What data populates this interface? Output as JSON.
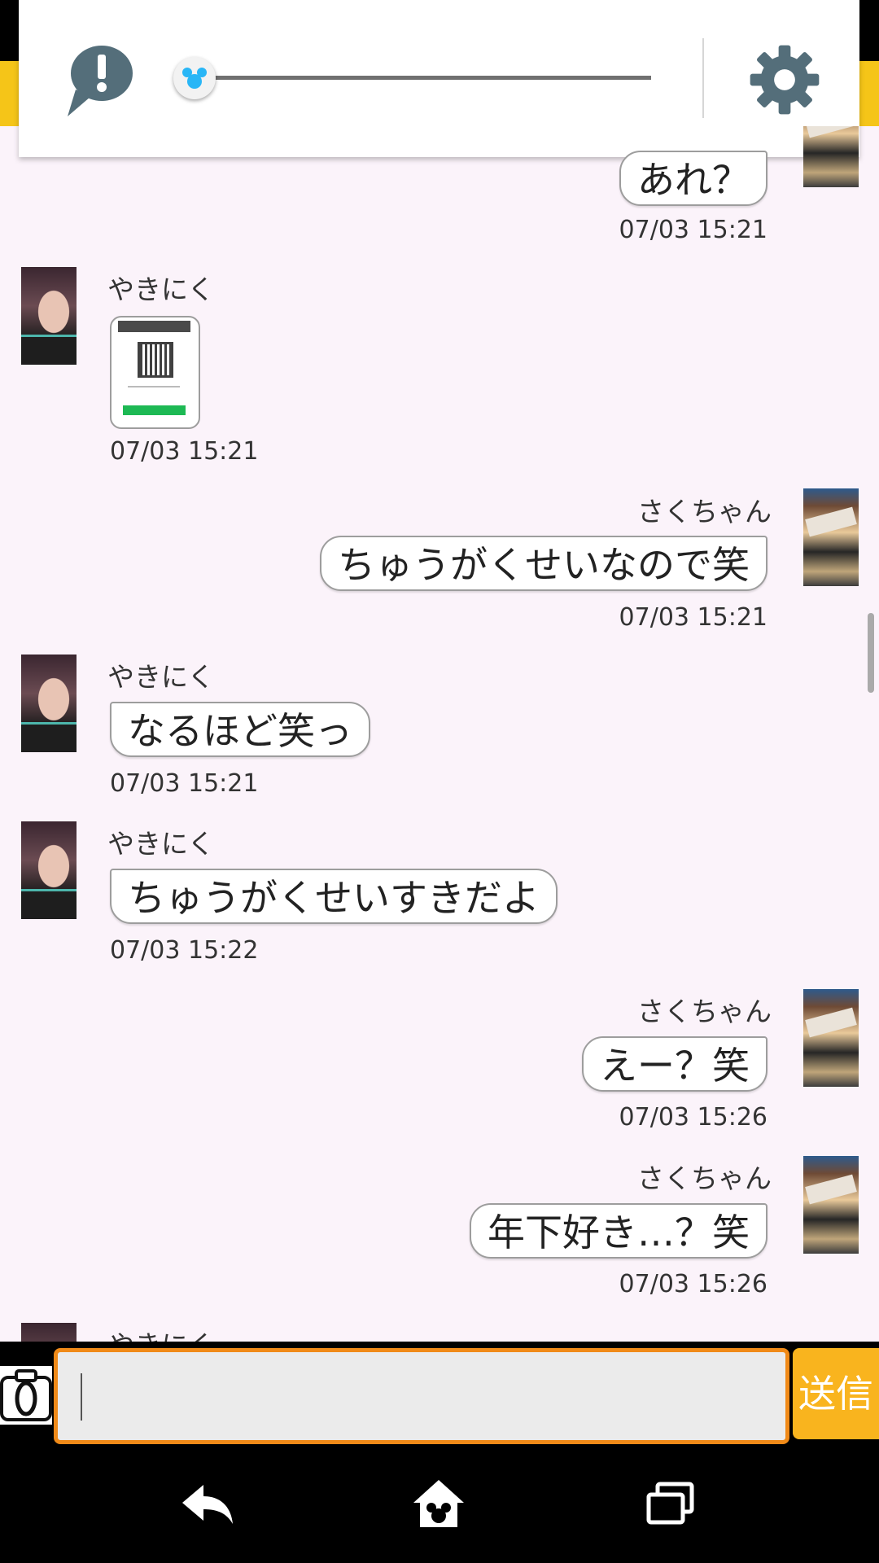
{
  "header": {
    "alert_icon": "speech-bubble-exclamation-icon",
    "slider_thumb_icon": "mouse-ears-icon",
    "slider_value": 0,
    "settings_icon": "gear-icon",
    "colors": {
      "panel": "#ffffff",
      "icon": "#546e7a",
      "accent_yellow": "#f5c518"
    }
  },
  "messages": [
    {
      "side": "right",
      "sender": "",
      "text": "あれ？",
      "time": "07/03 15:21"
    },
    {
      "side": "left",
      "sender": "やきにく",
      "type": "image",
      "image": "qr-code-screenshot",
      "time": "07/03 15:21"
    },
    {
      "side": "right",
      "sender": "さくちゃん",
      "text": "ちゅうがくせいなので笑",
      "time": "07/03 15:21"
    },
    {
      "side": "left",
      "sender": "やきにく",
      "text": "なるほど笑っ",
      "time": "07/03 15:21"
    },
    {
      "side": "left",
      "sender": "やきにく",
      "text": "ちゅうがくせいすきだよ",
      "time": "07/03 15:22"
    },
    {
      "side": "right",
      "sender": "さくちゃん",
      "text": "えー？笑",
      "time": "07/03 15:26"
    },
    {
      "side": "right",
      "sender": "さくちゃん",
      "text": "年下好き…？笑",
      "time": "07/03 15:26"
    },
    {
      "side": "left",
      "sender": "やきにく",
      "text": "",
      "time": ""
    }
  ],
  "composer": {
    "camera_icon": "camera-icon",
    "input_value": "",
    "send_label": "送信",
    "colors": {
      "border": "#f08a18",
      "send": "#f9b41e"
    }
  },
  "navbar": {
    "back_icon": "back-arrow-icon",
    "home_icon": "home-icon",
    "recents_icon": "recent-apps-icon"
  }
}
